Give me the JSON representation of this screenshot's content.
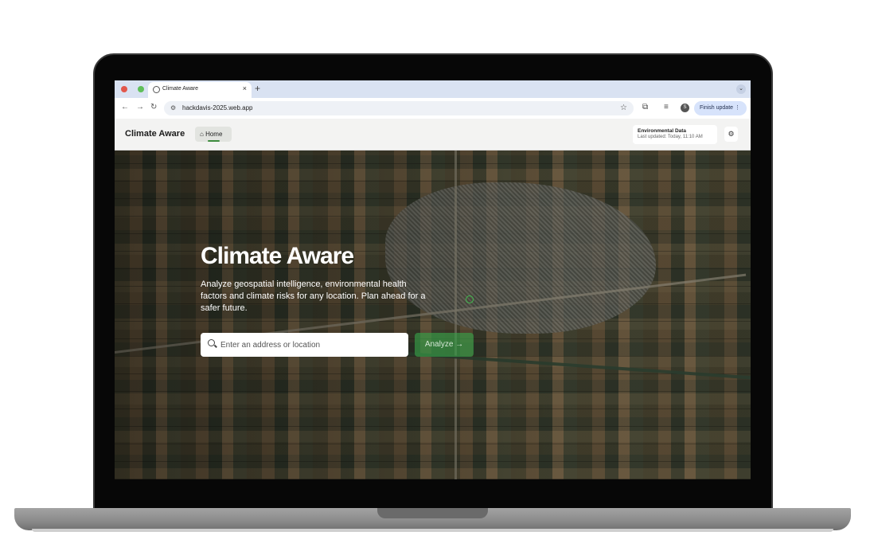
{
  "browser": {
    "tab_title": "Climate Aware",
    "tab_close": "×",
    "new_tab": "+",
    "tab_menu": "⌄",
    "url": "hackdavis-2025.web.app",
    "profile_initial": "S",
    "finish_update_label": "Finish update ⋮",
    "nav": {
      "back": "←",
      "forward": "→",
      "reload": "↻"
    },
    "icons": {
      "site_info": "site-info-icon",
      "star": "star-icon",
      "extensions": "puzzle-icon",
      "media": "media-control-icon"
    }
  },
  "app": {
    "brand": "Climate Aware",
    "nav_home_label": "Home",
    "env_title": "Environmental Data",
    "env_updated": "Last updated: Today, 11:10 AM",
    "settings_icon": "gear-icon",
    "accent_color": "#3d8b3d"
  },
  "hero": {
    "title": "Climate Aware",
    "description": "Analyze geospatial intelligence, environmental health factors and climate risks for any location. Plan ahead for a safer future.",
    "search_placeholder": "Enter an address or location",
    "analyze_label": "Analyze →"
  }
}
